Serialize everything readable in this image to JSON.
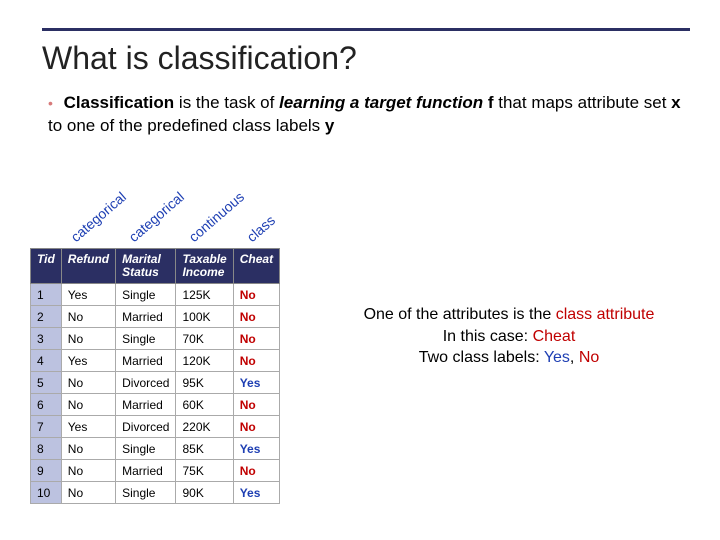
{
  "title": "What is classification?",
  "intro": {
    "bullet": "•",
    "s1a": "Classification",
    "s1b": " is the task of ",
    "s1c": "learning a target function",
    "s1d": " ",
    "s1e": "f",
    "s1f": " that maps attribute set ",
    "s1g": "x",
    "s1h": " to one of the predefined class labels ",
    "s1i": "y"
  },
  "labels": {
    "col1": "categorical",
    "col2": "categorical",
    "col3": "continuous",
    "col4": "class"
  },
  "table": {
    "headers": {
      "tid": "Tid",
      "refund": "Refund",
      "marital": "Marital Status",
      "income": "Taxable Income",
      "cheat": "Cheat"
    },
    "rows": [
      {
        "tid": "1",
        "refund": "Yes",
        "marital": "Single",
        "income": "125K",
        "cheat": "No"
      },
      {
        "tid": "2",
        "refund": "No",
        "marital": "Married",
        "income": "100K",
        "cheat": "No"
      },
      {
        "tid": "3",
        "refund": "No",
        "marital": "Single",
        "income": "70K",
        "cheat": "No"
      },
      {
        "tid": "4",
        "refund": "Yes",
        "marital": "Married",
        "income": "120K",
        "cheat": "No"
      },
      {
        "tid": "5",
        "refund": "No",
        "marital": "Divorced",
        "income": "95K",
        "cheat": "Yes"
      },
      {
        "tid": "6",
        "refund": "No",
        "marital": "Married",
        "income": "60K",
        "cheat": "No"
      },
      {
        "tid": "7",
        "refund": "Yes",
        "marital": "Divorced",
        "income": "220K",
        "cheat": "No"
      },
      {
        "tid": "8",
        "refund": "No",
        "marital": "Single",
        "income": "85K",
        "cheat": "Yes"
      },
      {
        "tid": "9",
        "refund": "No",
        "marital": "Married",
        "income": "75K",
        "cheat": "No"
      },
      {
        "tid": "10",
        "refund": "No",
        "marital": "Single",
        "income": "90K",
        "cheat": "Yes"
      }
    ]
  },
  "explain": {
    "line1a": "One of the attributes is the ",
    "line1b": "class attribute",
    "line2a": "In this case: ",
    "line2b": "Cheat",
    "line3a": "Two class labels: ",
    "line3b": "Yes",
    "line3c": ", ",
    "line3d": "No"
  }
}
